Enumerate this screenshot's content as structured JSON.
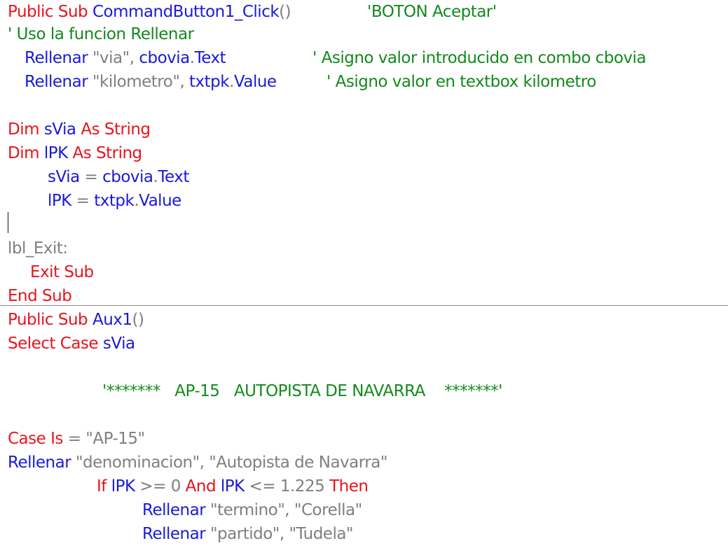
{
  "colors": {
    "keyword": "#e8141d",
    "identifier": "#1a1ad8",
    "string": "#7f7f7f",
    "comment": "#138a1b",
    "background": "#ffffff"
  },
  "code": {
    "l1": {
      "a": "Public Sub ",
      "b": "CommandButton1_Click",
      "c": "()",
      "d": "'BOTON Aceptar'"
    },
    "l2": {
      "a": "' Uso la funcion Rellenar"
    },
    "l3": {
      "a": "Rellenar ",
      "b": "\"via\"",
      "c": ", ",
      "d": "cbovia",
      "e": ".",
      "f": "Text",
      "g": "' Asigno valor introducido en combo cbovia"
    },
    "l4": {
      "a": "Rellenar ",
      "b": "\"kilometro\"",
      "c": ", ",
      "d": "txtpk",
      "e": ".",
      "f": "Value",
      "g": "' Asigno valor en textbox kilometro"
    },
    "l6": {
      "a": "Dim ",
      "b": "sVia",
      "c": " As String"
    },
    "l7": {
      "a": "Dim ",
      "b": "lPK",
      "c": " As String"
    },
    "l8": {
      "a": "sVia",
      "b": " = ",
      "c": "cbovia",
      "d": ".",
      "e": "Text"
    },
    "l9": {
      "a": "lPK",
      "b": " = ",
      "c": "txtpk",
      "d": ".",
      "e": "Value"
    },
    "l11": {
      "a": "lbl_Exit:"
    },
    "l12": {
      "a": "Exit Sub"
    },
    "l13": {
      "a": "End Sub"
    },
    "l14": {
      "a": "Public Sub ",
      "b": "Aux1",
      "c": "()"
    },
    "l15": {
      "a": "Select Case ",
      "b": "sVia"
    },
    "l17": {
      "a": "'*******   AP-15   AUTOPISTA DE NAVARRA    *******'"
    },
    "l19": {
      "a": "Case Is ",
      "b": "= ",
      "c": "\"AP-15\""
    },
    "l20": {
      "a": "Rellenar ",
      "b": "\"denominacion\", \"Autopista de Navarra\""
    },
    "l21": {
      "a": "If ",
      "b": "lPK",
      "c": " >= 0 ",
      "d": "And ",
      "e": "lPK",
      "f": " <= 1.225 ",
      "g": "Then"
    },
    "l22": {
      "a": "Rellenar ",
      "b": "\"termino\", \"Corella\""
    },
    "l23": {
      "a": "Rellenar ",
      "b": "\"partido\", \"Tudela\""
    }
  }
}
